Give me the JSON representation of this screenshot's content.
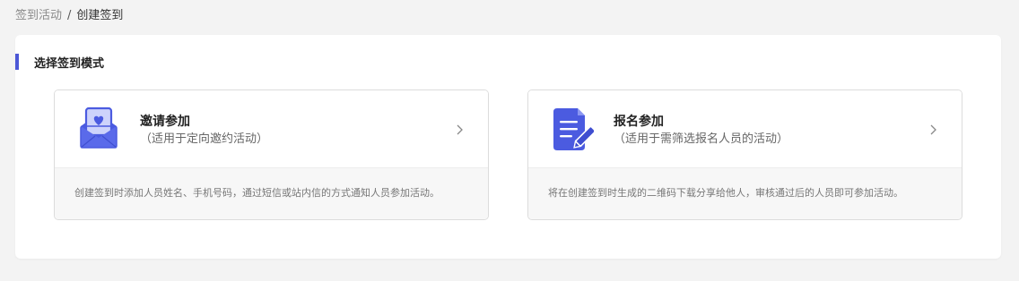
{
  "breadcrumb": {
    "parent": "签到活动",
    "separator": "/",
    "current": "创建签到"
  },
  "section": {
    "title": "选择签到模式"
  },
  "cards": [
    {
      "title": "邀请参加",
      "subtitle": "（适用于定向邀约活动）",
      "description": "创建签到时添加人员姓名、手机号码，通过短信或站内信的方式通知人员参加活动。",
      "icon": "envelope-heart-icon"
    },
    {
      "title": "报名参加",
      "subtitle": "（适用于需筛选报名人员的活动）",
      "description": "将在创建签到时生成的二维码下载分享给他人，审核通过后的人员即可参加活动。",
      "icon": "document-edit-icon"
    }
  ],
  "colors": {
    "accent": "#4c57d6",
    "icon_primary": "#4b5be0",
    "icon_light": "#cdd3fb",
    "background": "#f3f3f3"
  }
}
